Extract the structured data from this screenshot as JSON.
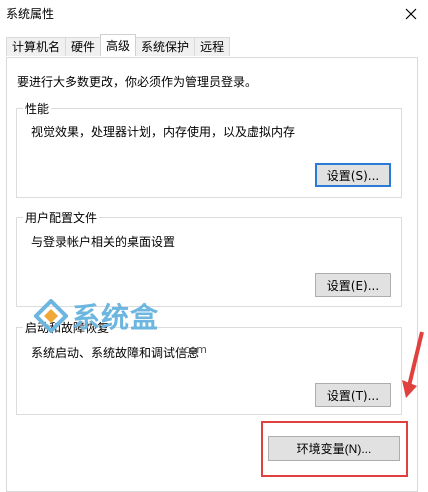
{
  "window": {
    "title": "系统属性",
    "close_icon": "close-icon"
  },
  "tabs": [
    {
      "label": "计算机名",
      "active": false
    },
    {
      "label": "硬件",
      "active": false
    },
    {
      "label": "高级",
      "active": true
    },
    {
      "label": "系统保护",
      "active": false
    },
    {
      "label": "远程",
      "active": false
    }
  ],
  "admin_note": "要进行大多数更改，你必须作为管理员登录。",
  "performance": {
    "legend": "性能",
    "description": "视觉效果，处理器计划，内存使用，以及虚拟内存",
    "button": "设置(S)..."
  },
  "user_profiles": {
    "legend": "用户配置文件",
    "description": "与登录帐户相关的桌面设置",
    "button": "设置(E)..."
  },
  "startup_recovery": {
    "legend": "启动和故障恢复",
    "description": "系统启动、系统故障和调试信息",
    "button": "设置(T)..."
  },
  "env_button": "环境变量(N)...",
  "watermark": {
    "text": "系统盒",
    "suffix": ".com"
  },
  "colors": {
    "highlight": "#e0413e",
    "focus": "#2a7bd6",
    "watermark": "#6cb6e0"
  }
}
